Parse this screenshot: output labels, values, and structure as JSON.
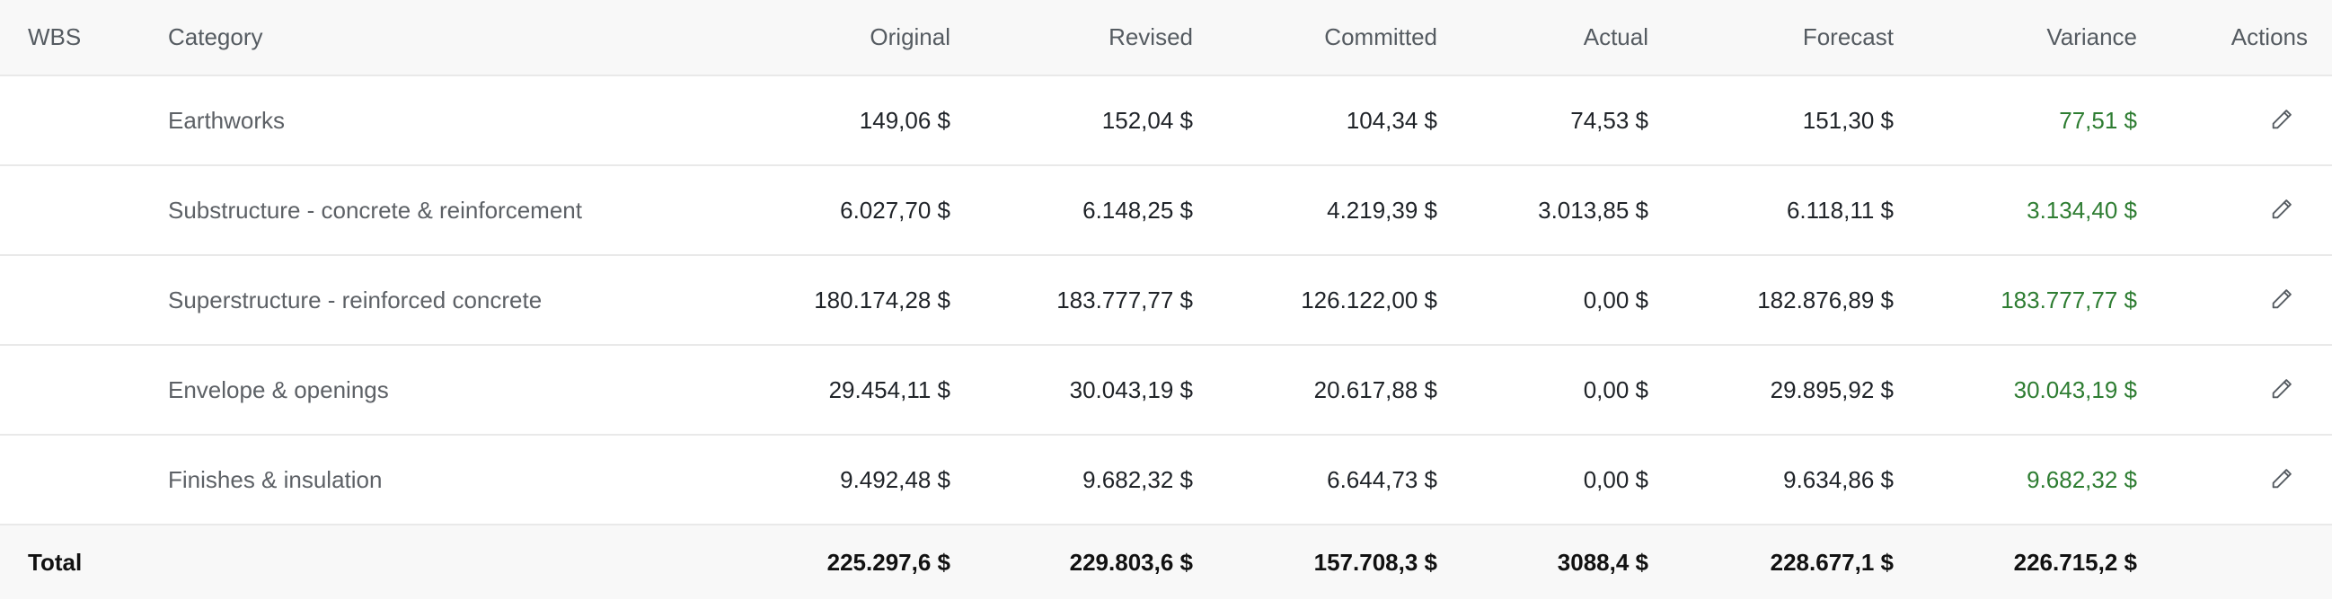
{
  "table": {
    "columns": {
      "wbs": "WBS",
      "category": "Category",
      "original": "Original",
      "revised": "Revised",
      "committed": "Committed",
      "actual": "Actual",
      "forecast": "Forecast",
      "variance": "Variance",
      "actions": "Actions"
    },
    "rows": [
      {
        "wbs": "",
        "category": "Earthworks",
        "original": "149,06 $",
        "revised": "152,04 $",
        "committed": "104,34 $",
        "actual": "74,53 $",
        "forecast": "151,30 $",
        "variance": "77,51 $"
      },
      {
        "wbs": "",
        "category": "Substructure - concrete & reinforcement",
        "original": "6.027,70 $",
        "revised": "6.148,25 $",
        "committed": "4.219,39 $",
        "actual": "3.013,85 $",
        "forecast": "6.118,11 $",
        "variance": "3.134,40 $"
      },
      {
        "wbs": "",
        "category": "Superstructure - reinforced concrete",
        "original": "180.174,28 $",
        "revised": "183.777,77 $",
        "committed": "126.122,00 $",
        "actual": "0,00 $",
        "forecast": "182.876,89 $",
        "variance": "183.777,77 $"
      },
      {
        "wbs": "",
        "category": "Envelope & openings",
        "original": "29.454,11 $",
        "revised": "30.043,19 $",
        "committed": "20.617,88 $",
        "actual": "0,00 $",
        "forecast": "29.895,92 $",
        "variance": "30.043,19 $"
      },
      {
        "wbs": "",
        "category": "Finishes & insulation",
        "original": "9.492,48 $",
        "revised": "9.682,32 $",
        "committed": "6.644,73 $",
        "actual": "0,00 $",
        "forecast": "9.634,86 $",
        "variance": "9.682,32 $"
      }
    ],
    "total": {
      "label": "Total",
      "original": "225.297,6 $",
      "revised": "229.803,6 $",
      "committed": "157.708,3 $",
      "actual": "3088,4 $",
      "forecast": "228.677,1 $",
      "variance": "226.715,2 $"
    },
    "row_action_icon": "pencil-icon"
  },
  "colors": {
    "variance_positive": "#2e7d32",
    "header_background": "#f8f8f8",
    "border": "#e9e9e9"
  }
}
